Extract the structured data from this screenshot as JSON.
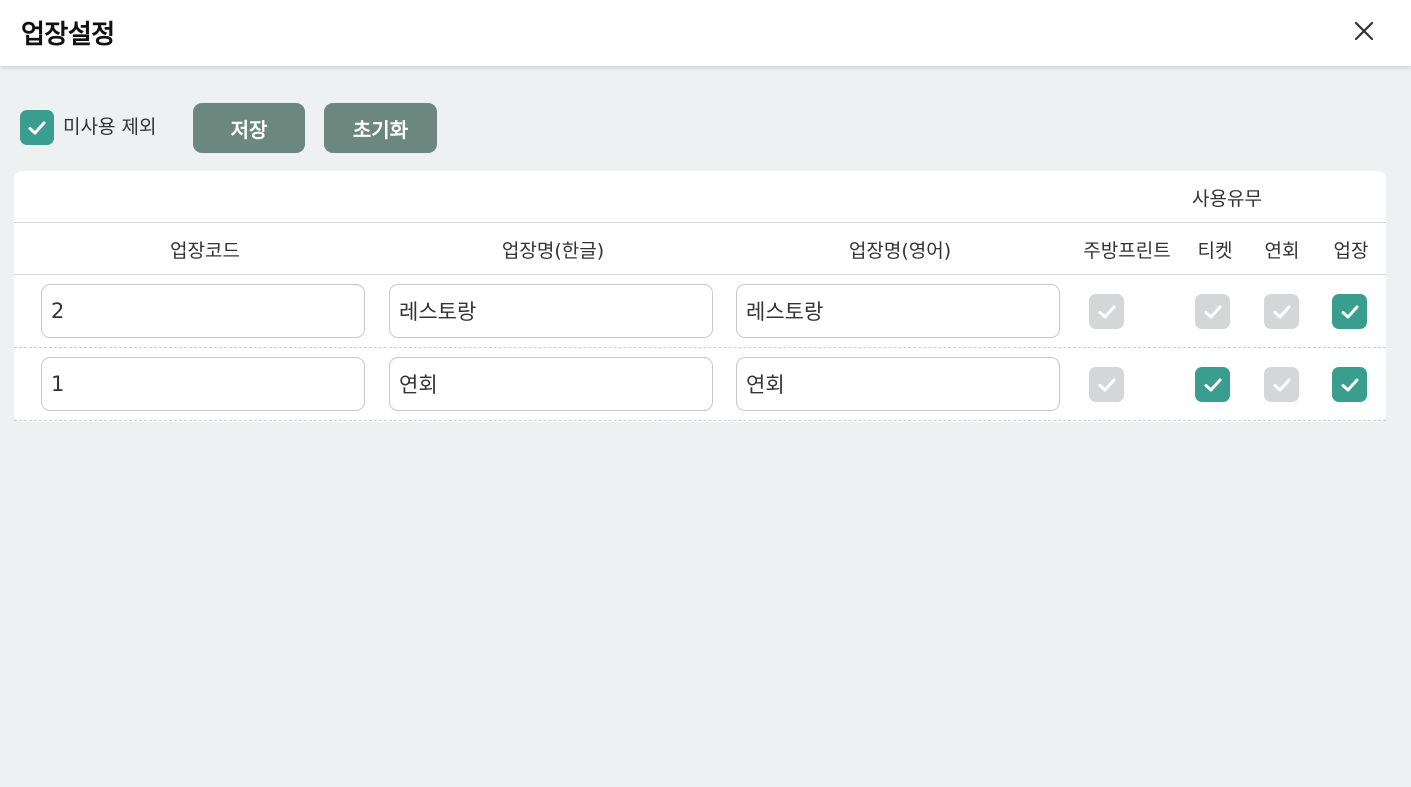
{
  "header": {
    "title": "업장설정",
    "close_icon": "close-icon"
  },
  "toolbar": {
    "exclude_unused_label": "미사용 제외",
    "exclude_unused_checked": true,
    "save_label": "저장",
    "reset_label": "초기화"
  },
  "colors": {
    "accent": "#3a9e8f",
    "button": "#6c877d",
    "checkbox_off": "#d4d6d7",
    "background": "#edf1f2"
  },
  "table": {
    "group_header": "사용유무",
    "columns": [
      "업장코드",
      "업장명(한글)",
      "업장명(영어)",
      "주방프린트",
      "티켓",
      "연회",
      "업장"
    ],
    "rows": [
      {
        "code": "2",
        "name_kr": "레스토랑",
        "name_en": "레스토랑",
        "kitchen_print": false,
        "ticket": false,
        "banquet": false,
        "venue": true
      },
      {
        "code": "1",
        "name_kr": "연회",
        "name_en": "연회",
        "kitchen_print": false,
        "ticket": true,
        "banquet": false,
        "venue": true
      }
    ]
  }
}
